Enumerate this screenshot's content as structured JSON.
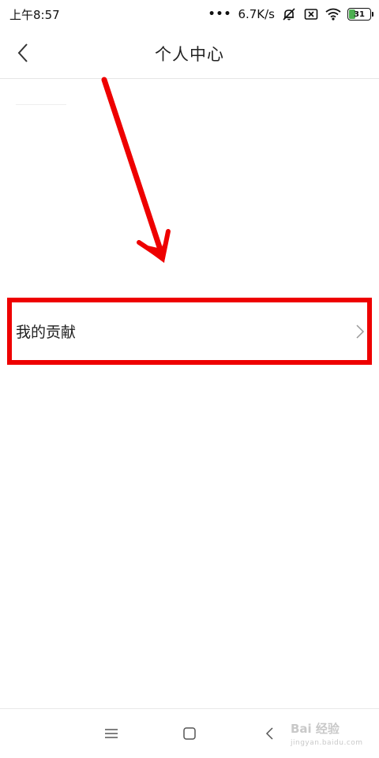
{
  "status_bar": {
    "time": "上午8:57",
    "dots": "•••",
    "speed": "6.7K/s",
    "battery_level": "31",
    "battery_fraction": 0.31,
    "icons": [
      "mute-bell-icon",
      "sim-x-icon",
      "wifi-icon",
      "battery-icon"
    ]
  },
  "header": {
    "title": "个人中心",
    "back_icon": "chevron-left-icon"
  },
  "list": {
    "items": [
      {
        "label": "我的贡献",
        "icon": "chevron-right-icon"
      }
    ]
  },
  "annotation": {
    "arrow_color": "#ee0000",
    "box_color": "#ee0000"
  },
  "nav": {
    "icons": [
      "menu-icon",
      "home-square-icon",
      "back-chevron-icon"
    ]
  },
  "watermark": {
    "main": "Bai  经验",
    "sub": "jingyan.baidu.com"
  }
}
